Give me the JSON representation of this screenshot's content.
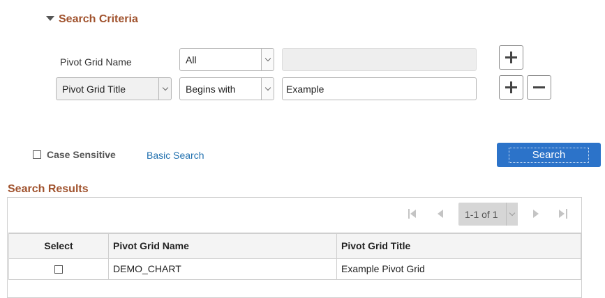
{
  "criteria": {
    "title": "Search Criteria",
    "row1": {
      "label": "Pivot Grid Name",
      "operator": "All",
      "value": ""
    },
    "row2": {
      "field": "Pivot Grid Title",
      "operator": "Begins with",
      "value": "Example"
    }
  },
  "options": {
    "case_sensitive_label": "Case Sensitive",
    "basic_search_label": "Basic Search",
    "search_button_label": "Search"
  },
  "results": {
    "title": "Search Results",
    "pager": {
      "range": "1-1 of 1"
    },
    "columns": [
      "Select",
      "Pivot Grid Name",
      "Pivot Grid Title"
    ],
    "rows": [
      {
        "name": "DEMO_CHART",
        "title": "Example Pivot Grid",
        "selected": false
      }
    ]
  },
  "colors": {
    "header_accent": "#a0522d",
    "link": "#1f6fae",
    "primary_button": "#2c73c9"
  },
  "icons": {
    "collapse": "triangle-down",
    "add": "plus",
    "remove": "minus",
    "dropdown": "chevron-down",
    "first": "first-page",
    "prev": "previous-page",
    "next": "next-page",
    "last": "last-page"
  }
}
